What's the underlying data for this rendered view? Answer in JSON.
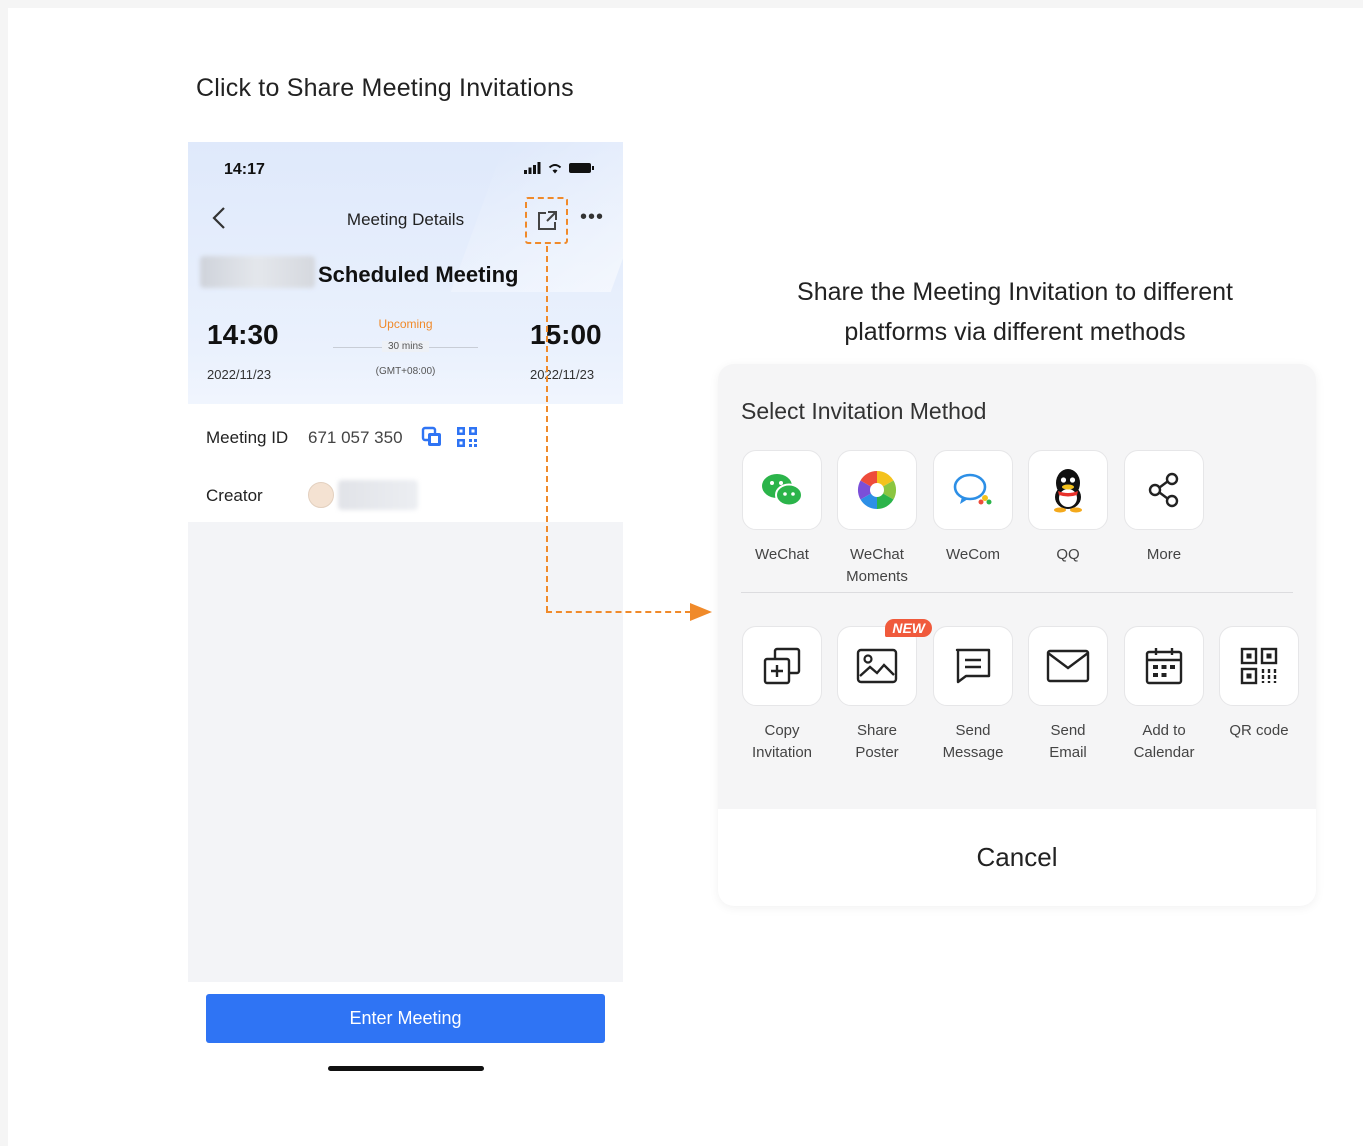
{
  "captions": {
    "left": "Click to Share Meeting Invitations",
    "right_line1": "Share the Meeting Invitation to different",
    "right_line2": "platforms via different methods"
  },
  "phone": {
    "status_time": "14:17",
    "nav_title": "Meeting Details",
    "meeting_title": "Scheduled Meeting",
    "start_time": "14:30",
    "start_date": "2022/11/23",
    "end_time": "15:00",
    "end_date": "2022/11/23",
    "status": "Upcoming",
    "duration": "30 mins",
    "timezone": "(GMT+08:00)",
    "meeting_id_label": "Meeting ID",
    "meeting_id": "671 057 350",
    "creator_label": "Creator",
    "enter_button": "Enter Meeting"
  },
  "panel": {
    "title": "Select Invitation Method",
    "row1": [
      {
        "label": "WeChat",
        "icon": "wechat-icon"
      },
      {
        "label": "WeChat Moments",
        "icon": "wechat-moments-icon"
      },
      {
        "label": "WeCom",
        "icon": "wecom-icon"
      },
      {
        "label": "QQ",
        "icon": "qq-icon"
      },
      {
        "label": "More",
        "icon": "share-icon"
      }
    ],
    "row2": [
      {
        "label": "Copy Invitation",
        "icon": "copy-invitation-icon"
      },
      {
        "label": "Share Poster",
        "icon": "image-icon",
        "badge": "NEW"
      },
      {
        "label": "Send Message",
        "icon": "message-icon"
      },
      {
        "label": "Send Email",
        "icon": "mail-icon"
      },
      {
        "label": "Add to Calendar",
        "icon": "calendar-icon"
      },
      {
        "label": "QR code",
        "icon": "qr-code-icon"
      }
    ],
    "cancel": "Cancel"
  },
  "colors": {
    "accent_orange": "#f08a2a",
    "primary_blue": "#2f74f4",
    "wechat_green": "#2bb44a"
  }
}
